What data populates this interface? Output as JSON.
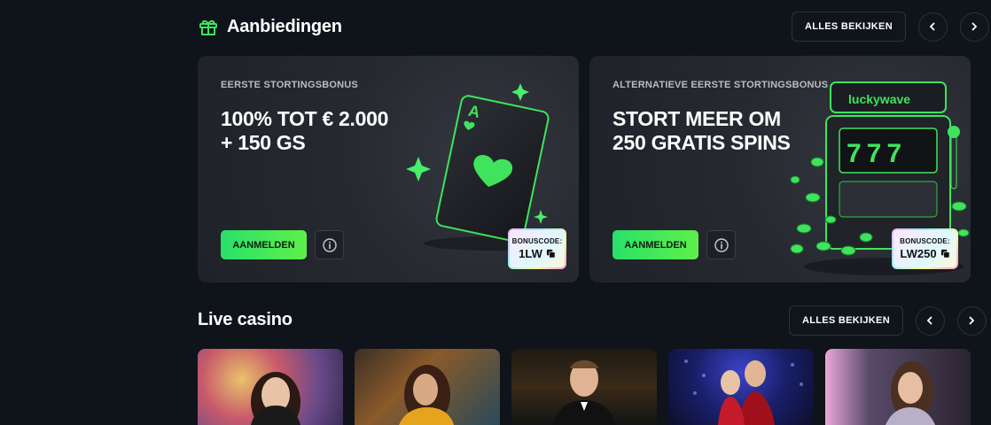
{
  "offers": {
    "title": "Aanbiedingen",
    "view_all": "ALLES BEKIJKEN",
    "cards": [
      {
        "kicker": "EERSTE STORTINGSBONUS",
        "title_line1": "100% TOT € 2.000",
        "title_line2": "+ 150 GS",
        "signup": "AANMELDEN",
        "code_label": "BONUSCODE:",
        "code": "1LW"
      },
      {
        "kicker": "ALTERNATIEVE EERSTE STORTINGSBONUS",
        "title_line1": "STORT MEER OM",
        "title_line2": "250 GRATIS SPINS",
        "signup": "AANMELDEN",
        "code_label": "BONUSCODE:",
        "code": "LW250"
      }
    ],
    "brand_logo_text": "luckywave",
    "slot_reels": "777"
  },
  "live_casino": {
    "title": "Live casino",
    "view_all": "ALLES BEKIJKEN",
    "tiles": [
      "game-1",
      "game-2",
      "game-3",
      "game-4",
      "game-5"
    ]
  },
  "colors": {
    "accent": "#3fe45c",
    "background": "#0f131a",
    "card": "#25282f"
  }
}
